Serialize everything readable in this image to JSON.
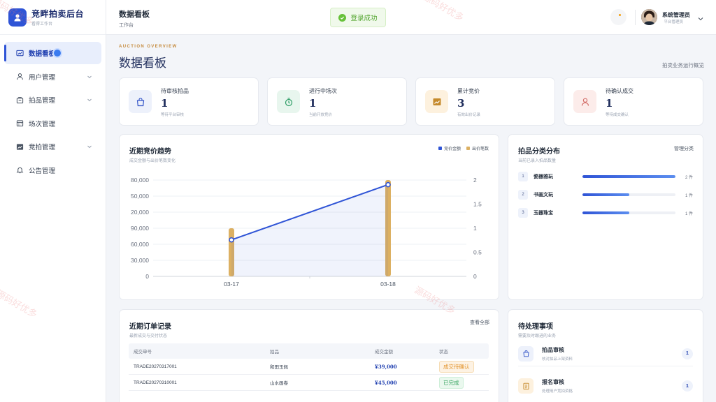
{
  "brand": {
    "title": "竞畔拍卖后台",
    "subtitle": "看得工作台"
  },
  "sidebar": {
    "items": [
      {
        "label": "数据看板",
        "icon": "chart-icon",
        "active": true
      },
      {
        "label": "用户管理",
        "icon": "user-icon",
        "expandable": true
      },
      {
        "label": "拍品管理",
        "icon": "box-icon",
        "expandable": true
      },
      {
        "label": "场次管理",
        "icon": "calendar-icon"
      },
      {
        "label": "竞拍管理",
        "icon": "trend-icon",
        "expandable": true
      },
      {
        "label": "公告管理",
        "icon": "bell-icon"
      }
    ]
  },
  "header": {
    "title": "数据看板",
    "breadcrumb": "工作台",
    "toast": "登录成功",
    "user_name": "系统管理员",
    "user_role": "平台管理员"
  },
  "overview": {
    "eyebrow": "AUCTION OVERVIEW",
    "title": "数据看板",
    "link": "拍卖业务运行概览"
  },
  "kpis": [
    {
      "label": "待审核拍品",
      "value": "1",
      "sub": "等待平台审核",
      "icon": "bag-icon",
      "color": "#3556c8",
      "bg": "#edf1fb"
    },
    {
      "label": "进行中场次",
      "value": "1",
      "sub": "当前开放竞价",
      "icon": "timer-icon",
      "color": "#2e9d66",
      "bg": "#e8f6ee"
    },
    {
      "label": "累计竞价",
      "value": "3",
      "sub": "有效出价记录",
      "icon": "chart-up-icon",
      "color": "#c58a2c",
      "bg": "#fdf1de"
    },
    {
      "label": "待确认成交",
      "value": "1",
      "sub": "等待成交确认",
      "icon": "person-icon",
      "color": "#d4706b",
      "bg": "#fcecea"
    }
  ],
  "trend": {
    "title": "近期竞价趋势",
    "subtitle": "成交金额与出价笔数变化"
  },
  "chart_data": {
    "type": "bar",
    "categories": [
      "03-17",
      "03-18"
    ],
    "series": [
      {
        "name": "竞价金额",
        "type": "line",
        "axis": "left",
        "color": "#2f54d6",
        "values": [
          39000,
          98000
        ]
      },
      {
        "name": "出价笔数",
        "type": "bar",
        "axis": "right",
        "color": "#dcb062",
        "values": [
          1,
          2
        ]
      }
    ],
    "y_left_ticks": [
      "80,000",
      "50,000",
      "20,000",
      "90,000",
      "60,000",
      "30,000",
      "0"
    ],
    "y_right_ticks": [
      "2",
      "1.5",
      "1",
      "0.5",
      "0"
    ],
    "y_right_range": [
      0,
      2
    ],
    "grid": true
  },
  "categories_panel": {
    "title": "拍品分类分布",
    "subtitle": "当前已录入拍品数量",
    "link": "管理分类",
    "items": [
      {
        "rank": "1",
        "name": "瓷器雅玩",
        "count": "2 件",
        "share": 1.0
      },
      {
        "rank": "2",
        "name": "书画文玩",
        "count": "1 件",
        "share": 0.5
      },
      {
        "rank": "3",
        "name": "玉器珠宝",
        "count": "1 件",
        "share": 0.5
      }
    ]
  },
  "orders": {
    "title": "近期订单记录",
    "subtitle": "最新成交与交付状态",
    "link": "查看全部",
    "columns": [
      "成交单号",
      "拍品",
      "成交金额",
      "状态"
    ],
    "rows": [
      {
        "id": "TRADE20270317001",
        "item": "和田玉佩",
        "amount": "¥39,000",
        "status": "成交待确认",
        "status_type": "warn"
      },
      {
        "id": "TRADE20270310001",
        "item": "山水画卷",
        "amount": "¥45,000",
        "status": "已完成",
        "status_type": "ok"
      }
    ]
  },
  "todos": {
    "title": "待处理事项",
    "subtitle": "需要及时跟进的业务",
    "items": [
      {
        "title": "拍品审核",
        "sub": "核对拍品上架资料",
        "count": "1",
        "icon": "bag-icon",
        "bg": "#edf1fb",
        "color": "#3556c8"
      },
      {
        "title": "报名审核",
        "sub": "处理用户竞拍资格",
        "count": "1",
        "icon": "doc-icon",
        "bg": "#fdf1de",
        "color": "#c58a2c"
      }
    ]
  },
  "watermark": "源码好优多"
}
